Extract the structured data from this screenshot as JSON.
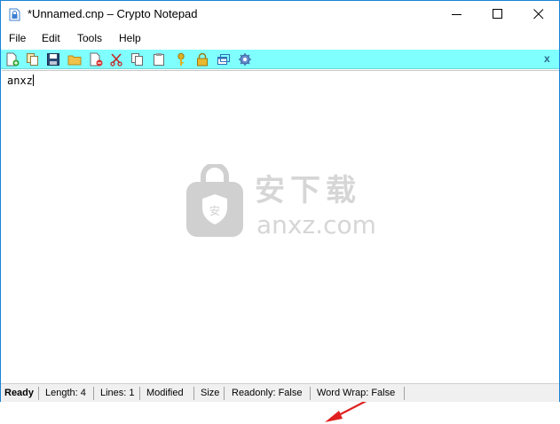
{
  "window": {
    "title": "*Unnamed.cnp – Crypto Notepad"
  },
  "menu": {
    "items": [
      "File",
      "Edit",
      "Tools",
      "Help"
    ]
  },
  "toolbar": {
    "buttons": [
      "new-file-icon",
      "copy-file-icon",
      "save-icon",
      "open-folder-icon",
      "delete-file-icon",
      "cut-icon",
      "copy-icon",
      "paste-icon",
      "key-icon",
      "lock-icon",
      "windows-icon",
      "settings-icon"
    ],
    "close_label": "x",
    "background": "#80ffff"
  },
  "editor": {
    "content": "anxz"
  },
  "watermark": {
    "cn": "安下载",
    "en": "anxz.com"
  },
  "status": {
    "state": "Ready",
    "length": "Length: 4",
    "lines": "Lines: 1",
    "modified": "Modified",
    "size": "Size",
    "readonly": "Readonly: False",
    "word_wrap": "Word Wrap: False"
  },
  "colors": {
    "accent": "#1883d7",
    "toolbar": "#80ffff",
    "arrow": "#e02020"
  }
}
